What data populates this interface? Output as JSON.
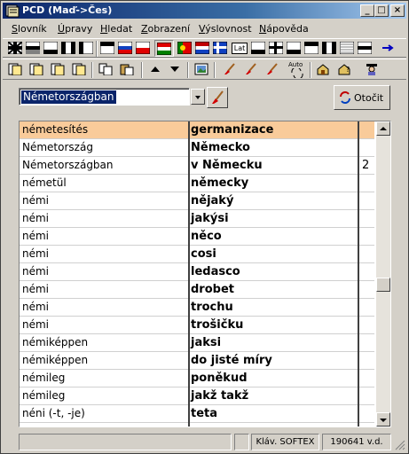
{
  "window": {
    "title": "PCD (Maď->Čes)"
  },
  "menu": [
    {
      "label": "Slovník",
      "ul": "S",
      "rest": "lovník"
    },
    {
      "label": "Úpravy",
      "ul": "Ú",
      "rest": "pravy"
    },
    {
      "label": "Hledat",
      "ul": "H",
      "rest": "ledat"
    },
    {
      "label": "Zobrazení",
      "ul": "Z",
      "rest": "obrazení"
    },
    {
      "label": "Výslovnost",
      "ul": "V",
      "rest": "ýslovnost"
    },
    {
      "label": "Nápověda",
      "ul": "N",
      "rest": "ápověda"
    }
  ],
  "toolbar1": {
    "items": [
      "uk-flag-icon",
      "stripe-flag-icon",
      "stripe-flag-icon",
      "stripe-flag-icon",
      "stripe-flag-icon",
      "flag-icon",
      "flag-icon",
      "stripe-flag-icon",
      "hungary-flag-icon",
      "portugal-flag-icon",
      "netherlands-flag-icon",
      "flag-icon",
      "latin-icon",
      "dictionary-icon",
      "dictionary-icon",
      "dictionary-icon",
      "dictionary-icon",
      "dictionary-icon",
      "dictionary-icon",
      "arrow-right-icon"
    ],
    "latin_label": "Lat"
  },
  "toolbar2": {
    "auto_label": "Auto"
  },
  "search": {
    "value": "Németországban"
  },
  "rotate_button": {
    "label": "Otočit"
  },
  "grid": {
    "rows": [
      {
        "hu": "németesítés",
        "cs": "germanizace",
        "n": ""
      },
      {
        "hu": "Németország",
        "cs": "Německo",
        "n": ""
      },
      {
        "hu": "Németországban",
        "cs": "v Německu",
        "n": "2"
      },
      {
        "hu": "németül",
        "cs": "německy",
        "n": ""
      },
      {
        "hu": "némi",
        "cs": "nějaký",
        "n": ""
      },
      {
        "hu": "némi",
        "cs": "jakýsi",
        "n": ""
      },
      {
        "hu": "némi",
        "cs": "něco",
        "n": ""
      },
      {
        "hu": "némi",
        "cs": "cosi",
        "n": ""
      },
      {
        "hu": "némi",
        "cs": "ledasco",
        "n": ""
      },
      {
        "hu": "némi",
        "cs": "drobet",
        "n": ""
      },
      {
        "hu": "némi",
        "cs": "trochu",
        "n": ""
      },
      {
        "hu": "némi",
        "cs": "trošičku",
        "n": ""
      },
      {
        "hu": "némiképpen",
        "cs": "jaksi",
        "n": ""
      },
      {
        "hu": "némiképpen",
        "cs": "do jisté míry",
        "n": ""
      },
      {
        "hu": "némileg",
        "cs": "poněkud",
        "n": ""
      },
      {
        "hu": "némileg",
        "cs": "jakž takž",
        "n": ""
      },
      {
        "hu": "néni (-t, -je)",
        "cs": "teta",
        "n": ""
      }
    ],
    "selected_color": "#f9cb9a"
  },
  "statusbar": {
    "keyboard": "Kláv. SOFTEX",
    "version": "190641 v.d."
  }
}
